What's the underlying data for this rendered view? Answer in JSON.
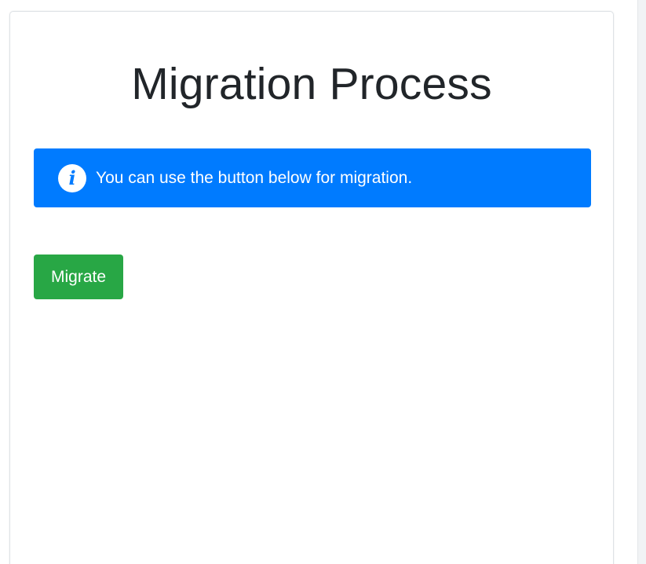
{
  "page": {
    "title": "Migration Process"
  },
  "alert": {
    "icon": "info-icon",
    "message": "You can use the button below for migration.",
    "color": "#007bff"
  },
  "actions": {
    "migrate_label": "Migrate",
    "migrate_color": "#28a745"
  }
}
